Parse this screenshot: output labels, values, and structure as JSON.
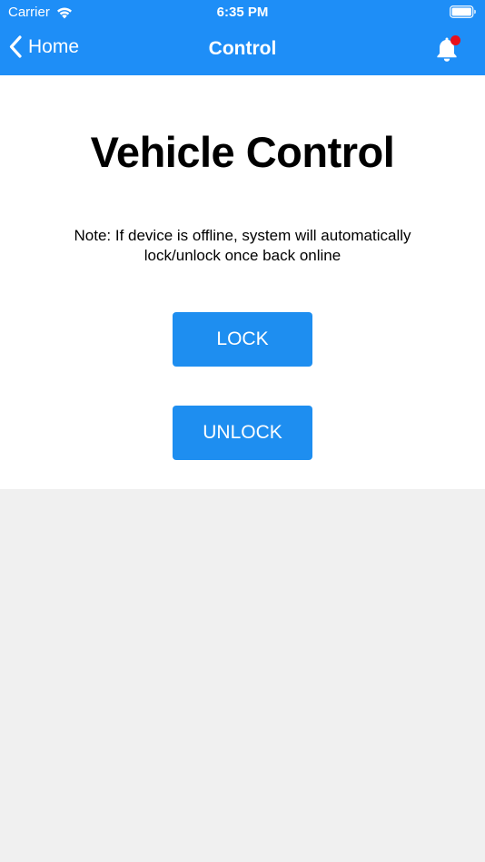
{
  "status_bar": {
    "carrier": "Carrier",
    "time": "6:35 PM"
  },
  "nav": {
    "back_label": "Home",
    "title": "Control",
    "notification_badge": true
  },
  "main": {
    "title": "Vehicle Control",
    "note": "Note: If device is offline, system will automatically lock/unlock once back online",
    "lock_label": "LOCK",
    "unlock_label": "UNLOCK"
  },
  "icons": {
    "wifi": "wifi-icon",
    "battery": "battery-icon",
    "back": "chevron-left-icon",
    "bell": "bell-icon"
  },
  "colors": {
    "header_bg": "#1e8ef7",
    "button_bg": "#1e8ef0",
    "badge": "#e8101c",
    "page_bg": "#f0f0f0",
    "content_bg": "#ffffff"
  }
}
